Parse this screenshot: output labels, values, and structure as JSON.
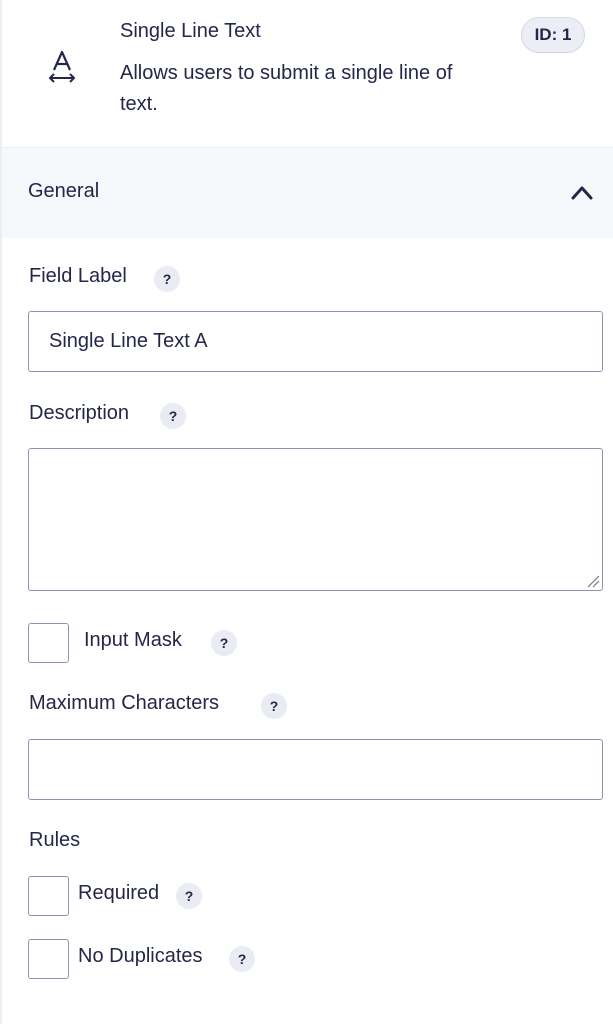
{
  "field": {
    "title": "Single Line Text",
    "description": "Allows users to submit a single line of text.",
    "id_badge": "ID: 1",
    "icon": "text-field-icon"
  },
  "section": {
    "title": "General",
    "toggle_icon": "chevron-up-icon"
  },
  "form": {
    "field_label": {
      "label": "Field Label",
      "help": "?",
      "value": "Single Line Text A"
    },
    "description": {
      "label": "Description",
      "help": "?",
      "value": ""
    },
    "input_mask": {
      "label": "Input Mask",
      "help": "?",
      "checked": false
    },
    "maximum_characters": {
      "label": "Maximum Characters",
      "help": "?",
      "value": ""
    },
    "rules": {
      "label": "Rules",
      "required": {
        "label": "Required",
        "help": "?",
        "checked": false
      },
      "no_duplicates": {
        "label": "No Duplicates",
        "help": "?",
        "checked": false
      }
    }
  },
  "colors": {
    "text": "#242748",
    "border": "#9092b2",
    "section_bg": "#f6f9fc",
    "badge_bg": "#eceef6"
  }
}
